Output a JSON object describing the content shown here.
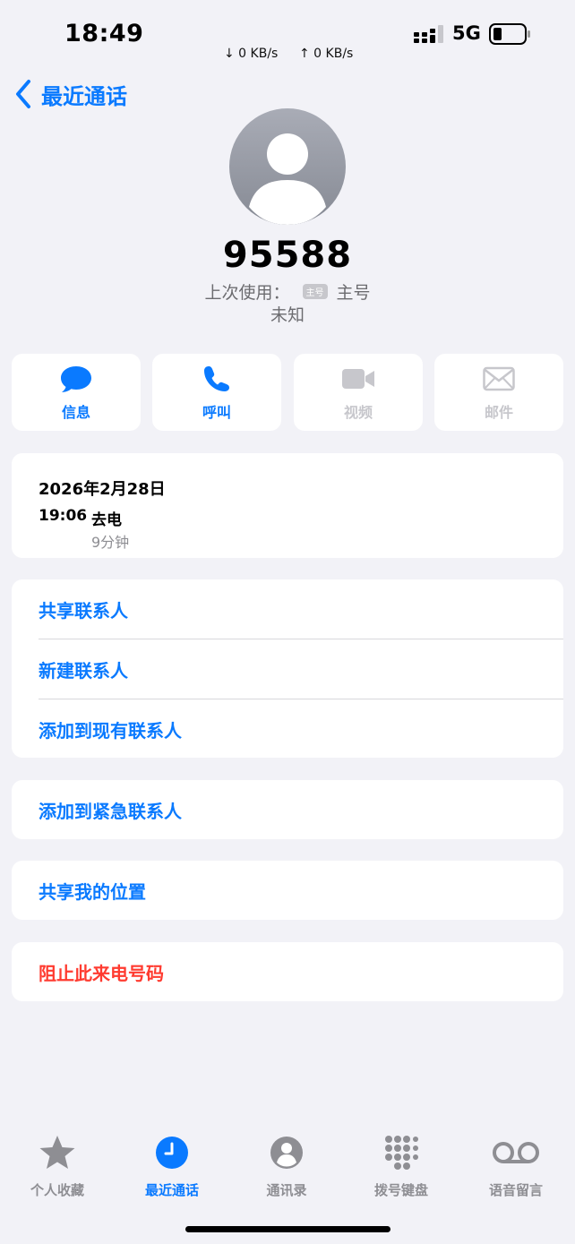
{
  "status_bar": {
    "time": "18:49",
    "download": "↓ 0 KB/s",
    "upload": "↑ 0 KB/s",
    "network": "5G"
  },
  "nav": {
    "back_label": "最近通话"
  },
  "contact": {
    "number": "95588",
    "last_used_label": "上次使用：",
    "tag": "主号",
    "line_label": "主号",
    "location": "未知"
  },
  "actions": [
    {
      "label": "信息",
      "icon": "message-icon",
      "enabled": true
    },
    {
      "label": "呼叫",
      "icon": "phone-icon",
      "enabled": true
    },
    {
      "label": "视频",
      "icon": "video-icon",
      "enabled": false
    },
    {
      "label": "邮件",
      "icon": "mail-icon",
      "enabled": false
    }
  ],
  "call_history": {
    "date": "2026年2月28日",
    "time": "19:06",
    "type": "去电",
    "duration": "9分钟"
  },
  "contact_options": [
    "共享联系人",
    "新建联系人",
    "添加到现有联系人"
  ],
  "emergency": {
    "label": "添加到紧急联系人"
  },
  "location_share": {
    "label": "共享我的位置"
  },
  "block": {
    "label": "阻止此来电号码"
  },
  "tabbar": {
    "items": [
      {
        "label": "个人收藏",
        "icon": "star-icon",
        "active": false
      },
      {
        "label": "最近通话",
        "icon": "clock-icon",
        "active": true
      },
      {
        "label": "通讯录",
        "icon": "contacts-icon",
        "active": false
      },
      {
        "label": "拨号键盘",
        "icon": "keypad-icon",
        "active": false
      },
      {
        "label": "语音留言",
        "icon": "voicemail-icon",
        "active": false
      }
    ]
  },
  "colors": {
    "accent": "#0a7aff",
    "destructive": "#ff3b30",
    "background": "#f2f2f7",
    "disabled": "#c7c7cc"
  }
}
